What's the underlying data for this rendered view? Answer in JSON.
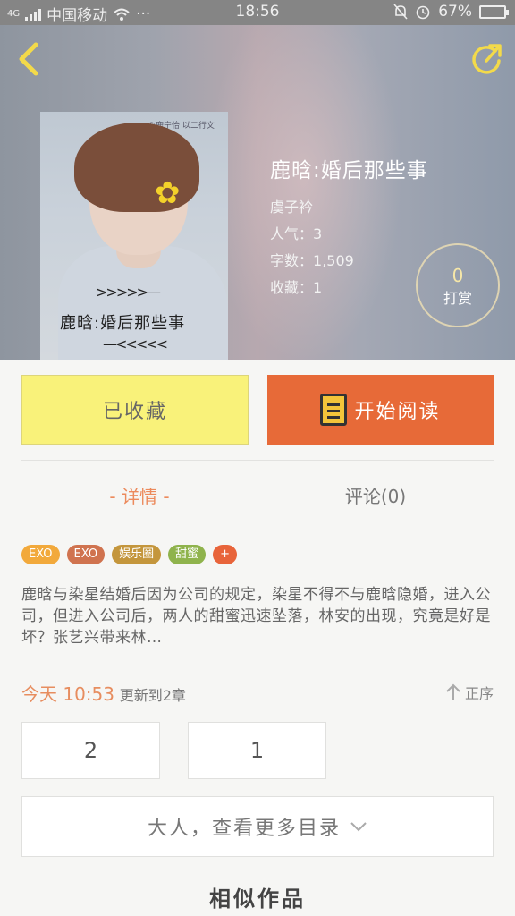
{
  "status_bar": {
    "network": "4G",
    "carrier": "中国移动",
    "more": "···",
    "time": "18:56",
    "battery": "67%",
    "battery_level": 0.67
  },
  "header": {
    "back_icon": "chevron-left-icon",
    "share_icon": "share-arrow-icon"
  },
  "cover": {
    "watermark": "©鹿宁怡 以二行文",
    "title": "鹿晗:婚后那些事"
  },
  "book": {
    "title": "鹿晗:婚后那些事",
    "author": "虞子衿",
    "popularity_label": "人气：",
    "popularity": "3",
    "words_label": "字数：",
    "words": "1,509",
    "favorites_label": "收藏：",
    "favorites": "1"
  },
  "tip": {
    "count": "0",
    "label": "打赏"
  },
  "actions": {
    "favorited_label": "已收藏",
    "read_label": "开始阅读"
  },
  "tabs": {
    "detail": "- 详情 -",
    "comments": "评论(0)"
  },
  "tags": [
    {
      "label": "EXO",
      "color": "#f2a93b"
    },
    {
      "label": "EXO",
      "color": "#d0734f"
    },
    {
      "label": "娱乐圈",
      "color": "#c4963c"
    },
    {
      "label": "甜蜜",
      "color": "#8fb34c"
    },
    {
      "label": "+",
      "color": "#e8643a"
    }
  ],
  "synopsis": "鹿晗与染星结婚后因为公司的规定，染星不得不与鹿晗隐婚，进入公司，但进入公司后，两人的甜蜜迅速坠落，林安的出现，究竟是好是坏？张艺兴带来林…",
  "update": {
    "time": "今天 10:53",
    "text": "更新到2章"
  },
  "sort": {
    "label": "正序",
    "icon": "arrow-up-icon"
  },
  "chapters": [
    "2",
    "1"
  ],
  "more_catalog": "大人，查看更多目录",
  "similar_title": "相似作品",
  "colors": {
    "accent_orange": "#e76a38",
    "favorite_yellow": "#f9f27a",
    "tab_active": "#ec8a5c"
  }
}
